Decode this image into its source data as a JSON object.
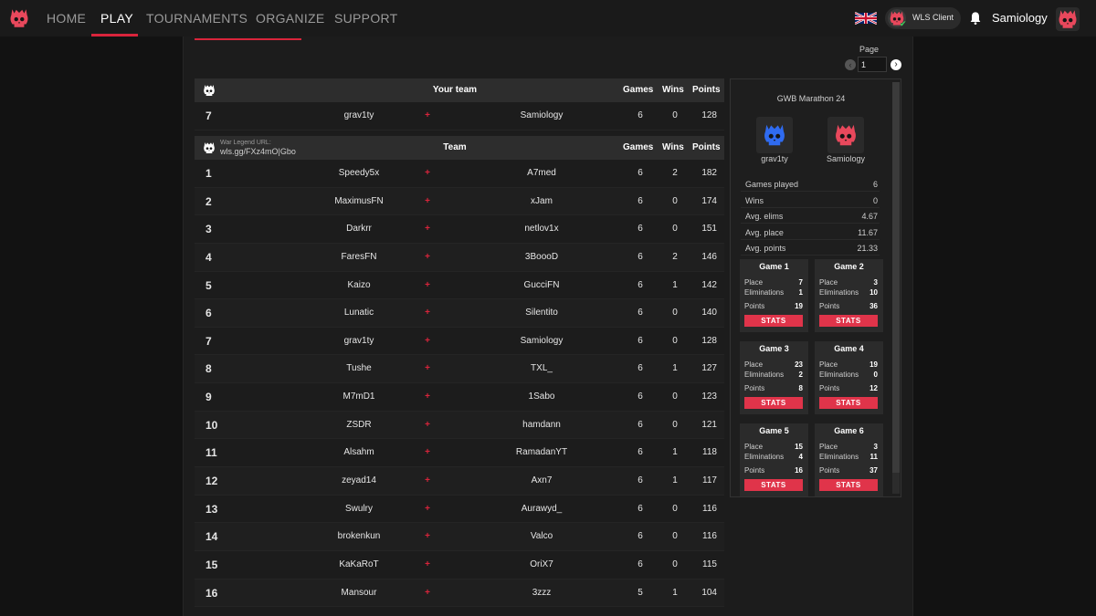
{
  "nav": {
    "links": [
      "HOME",
      "PLAY",
      "TOURNAMENTS",
      "ORGANIZE",
      "SUPPORT"
    ],
    "active": "PLAY",
    "client_label": "WLS Client",
    "username": "Samiology",
    "brand_color": "#d9243b"
  },
  "pager": {
    "label": "Page",
    "value": "1"
  },
  "your_team": {
    "header": "Your team",
    "cols": {
      "games": "Games",
      "wins": "Wins",
      "points": "Points"
    },
    "row": {
      "rank": "7",
      "p1": "grav1ty",
      "p2": "Samiology",
      "games": "6",
      "wins": "0",
      "points": "128"
    }
  },
  "standings": {
    "url_label": "War Legend URL:",
    "url": "wls.gg/FXz4mO|Gbo",
    "header": "Team",
    "cols": {
      "games": "Games",
      "wins": "Wins",
      "points": "Points"
    },
    "rows": [
      {
        "rank": "1",
        "p1": "Speedy5x",
        "p2": "A7med",
        "games": "6",
        "wins": "2",
        "points": "182"
      },
      {
        "rank": "2",
        "p1": "MaximusFN",
        "p2": "xJam",
        "games": "6",
        "wins": "0",
        "points": "174"
      },
      {
        "rank": "3",
        "p1": "Darkrr",
        "p2": "netlov1x",
        "games": "6",
        "wins": "0",
        "points": "151"
      },
      {
        "rank": "4",
        "p1": "FaresFN",
        "p2": "3BoooD",
        "games": "6",
        "wins": "2",
        "points": "146"
      },
      {
        "rank": "5",
        "p1": "Kaizo",
        "p2": "GucciFN",
        "games": "6",
        "wins": "1",
        "points": "142"
      },
      {
        "rank": "6",
        "p1": "Lunatic",
        "p2": "Silentito",
        "games": "6",
        "wins": "0",
        "points": "140"
      },
      {
        "rank": "7",
        "p1": "grav1ty",
        "p2": "Samiology",
        "games": "6",
        "wins": "0",
        "points": "128"
      },
      {
        "rank": "8",
        "p1": "Tushe",
        "p2": "TXL_",
        "games": "6",
        "wins": "1",
        "points": "127"
      },
      {
        "rank": "9",
        "p1": "M7mD1",
        "p2": "1Sabo",
        "games": "6",
        "wins": "0",
        "points": "123"
      },
      {
        "rank": "10",
        "p1": "ZSDR",
        "p2": "hamdann",
        "games": "6",
        "wins": "0",
        "points": "121"
      },
      {
        "rank": "11",
        "p1": "Alsahm",
        "p2": "RamadanYT",
        "games": "6",
        "wins": "1",
        "points": "118"
      },
      {
        "rank": "12",
        "p1": "zeyad14",
        "p2": "Axn7",
        "games": "6",
        "wins": "1",
        "points": "117"
      },
      {
        "rank": "13",
        "p1": "Swulry",
        "p2": "Aurawyd_",
        "games": "6",
        "wins": "0",
        "points": "116"
      },
      {
        "rank": "14",
        "p1": "brokenkun",
        "p2": "Valco",
        "games": "6",
        "wins": "0",
        "points": "116"
      },
      {
        "rank": "15",
        "p1": "KaKaRoT",
        "p2": "OriX7",
        "games": "6",
        "wins": "0",
        "points": "115"
      },
      {
        "rank": "16",
        "p1": "Mansour",
        "p2": "3zzz",
        "games": "5",
        "wins": "1",
        "points": "104"
      }
    ]
  },
  "side": {
    "title": "GWB Marathon 24",
    "player1": {
      "name": "grav1ty",
      "color": "#2f6bf0"
    },
    "player2": {
      "name": "Samiology",
      "color": "#e8485c"
    },
    "stats": [
      {
        "k": "Games played",
        "v": "6"
      },
      {
        "k": "Wins",
        "v": "0"
      },
      {
        "k": "Avg. elims",
        "v": "4.67"
      },
      {
        "k": "Avg. place",
        "v": "11.67"
      },
      {
        "k": "Avg. points",
        "v": "21.33"
      }
    ],
    "labels": {
      "place": "Place",
      "elims": "Eliminations",
      "points": "Points",
      "button": "STATS"
    },
    "games": [
      {
        "title": "Game 1",
        "place": "7",
        "elims": "1",
        "points": "19"
      },
      {
        "title": "Game 2",
        "place": "3",
        "elims": "10",
        "points": "36"
      },
      {
        "title": "Game 3",
        "place": "23",
        "elims": "2",
        "points": "8"
      },
      {
        "title": "Game 4",
        "place": "19",
        "elims": "0",
        "points": "12"
      },
      {
        "title": "Game 5",
        "place": "15",
        "elims": "4",
        "points": "16"
      },
      {
        "title": "Game 6",
        "place": "3",
        "elims": "11",
        "points": "37"
      }
    ]
  }
}
